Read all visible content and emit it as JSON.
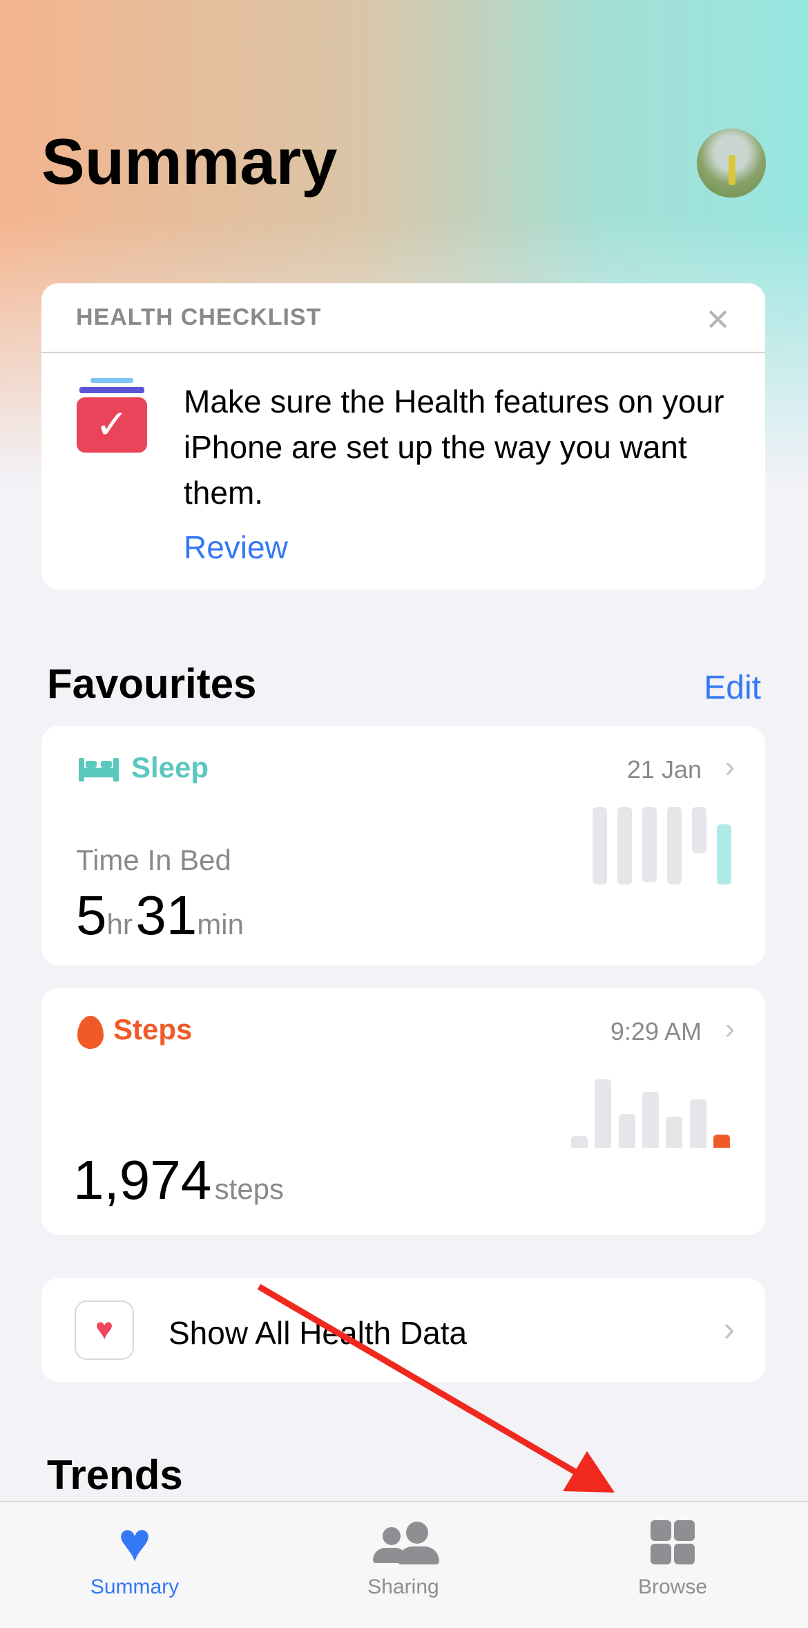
{
  "header": {
    "title": "Summary",
    "avatar": "profile-photo"
  },
  "checklist": {
    "heading": "HEALTH CHECKLIST",
    "message": "Make sure the Health features on your iPhone are set up the way you want them.",
    "action": "Review",
    "icon": "checklist-icon"
  },
  "favourites": {
    "title": "Favourites",
    "edit": "Edit",
    "sleep": {
      "title": "Sleep",
      "date": "21 Jan",
      "label": "Time In Bed",
      "hours": "5",
      "hours_unit": "hr",
      "minutes": "31",
      "minutes_unit": "min",
      "color": "#5ac8be",
      "bar_values": [
        1.0,
        1.0,
        0.97,
        1.0,
        0.6,
        0.78
      ]
    },
    "steps": {
      "title": "Steps",
      "time": "9:29 AM",
      "value": "1,974",
      "unit": "steps",
      "color": "#f05a28",
      "bar_values": [
        17,
        99,
        49,
        81,
        45,
        70,
        19
      ]
    }
  },
  "show_all": {
    "label": "Show All Health Data"
  },
  "trends": {
    "title": "Trends"
  },
  "tabs": [
    {
      "label": "Summary",
      "active": true
    },
    {
      "label": "Sharing",
      "active": false
    },
    {
      "label": "Browse",
      "active": false
    }
  ],
  "colors": {
    "accent": "#3478f6",
    "annotation_arrow": "#f0281e"
  }
}
